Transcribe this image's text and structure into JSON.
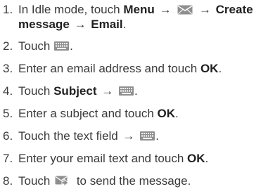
{
  "steps": [
    {
      "num": "1.",
      "parts": {
        "t1": "In Idle mode, touch ",
        "b1": "Menu",
        "arrow1": "→",
        "arrow2": "→",
        "b2": "Create message",
        "arrow3": "→",
        "b3": "Email",
        "t2": "."
      }
    },
    {
      "num": "2.",
      "parts": {
        "t1": "Touch ",
        "t2": "."
      }
    },
    {
      "num": "3.",
      "parts": {
        "t1": "Enter an email address and touch ",
        "b1": "OK",
        "t2": "."
      }
    },
    {
      "num": "4.",
      "parts": {
        "t1": "Touch ",
        "b1": "Subject",
        "arrow1": "→",
        "t2": "."
      }
    },
    {
      "num": "5.",
      "parts": {
        "t1": "Enter a subject and touch ",
        "b1": "OK",
        "t2": "."
      }
    },
    {
      "num": "6.",
      "parts": {
        "t1": "Touch the text field ",
        "arrow1": "→",
        "t2": "."
      }
    },
    {
      "num": "7.",
      "parts": {
        "t1": "Enter your email text and touch ",
        "b1": "OK",
        "t2": "."
      }
    },
    {
      "num": "8.",
      "parts": {
        "t1": "Touch ",
        "t2": " to send the message."
      }
    }
  ],
  "icons": {
    "envelope": "envelope-icon",
    "keyboard": "keyboard-icon",
    "send": "send-message-icon"
  },
  "colors": {
    "text": "#3a3a3a",
    "bold": "#1f1f1f",
    "icon_fill": "#8f8f8f"
  }
}
